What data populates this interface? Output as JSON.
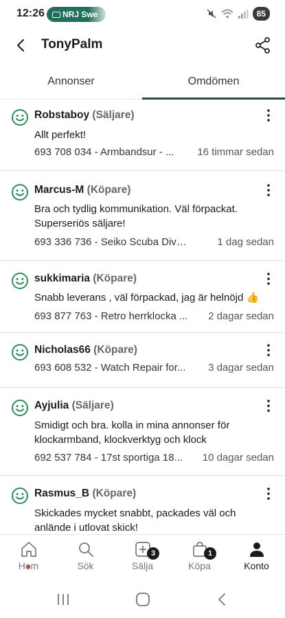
{
  "status_bar": {
    "time": "12:26",
    "notification": "NRJ Swe",
    "battery": "85"
  },
  "header": {
    "title": "TonyPalm",
    "back_icon": "chevron-left-icon",
    "share_icon": "share-icon"
  },
  "tabs": [
    {
      "label": "Annonser",
      "active": false
    },
    {
      "label": "Omdömen",
      "active": true
    }
  ],
  "reviews": [
    {
      "user": "Robstaboy",
      "role": "(Säljare)",
      "text": "Allt perfekt!",
      "item": "693 708 034 - Armbandsur - ...",
      "time": "16 timmar sedan"
    },
    {
      "user": "Marcus-M",
      "role": "(Köpare)",
      "text": "Bra och tydlig kommunikation. Väl förpackat. Superseriös säljare!",
      "item": "693 336 736 - Seiko Scuba Diver'...",
      "time": "1 dag sedan"
    },
    {
      "user": "sukkimaria",
      "role": "(Köpare)",
      "text": "Snabb leverans , väl förpackad, jag är helnöjd 👍",
      "item": "693 877 763 - Retro herrklocka ...",
      "time": "2 dagar sedan"
    },
    {
      "user": "Nicholas66",
      "role": "(Köpare)",
      "text": "",
      "item": "693 608 532 - Watch Repair for...",
      "time": "3 dagar sedan"
    },
    {
      "user": "Ayjulia",
      "role": "(Säljare)",
      "text": "Smidigt och bra. kolla in mina annonser för klockarmband, klockverktyg och klock",
      "item": "692 537 784 - 17st sportiga 18...",
      "time": "10 dagar sedan"
    },
    {
      "user": "Rasmus_B",
      "role": "(Köpare)",
      "text": "Skickades mycket snabbt, packades väl och anlände i utlovat skick!",
      "item": "",
      "time": ""
    }
  ],
  "bottom_nav": [
    {
      "label": "Hem",
      "icon": "home-icon"
    },
    {
      "label": "Sök",
      "icon": "search-icon"
    },
    {
      "label": "Sälja",
      "icon": "add-icon",
      "badge": "3"
    },
    {
      "label": "Köpa",
      "icon": "bag-icon",
      "badge": "1"
    },
    {
      "label": "Konto",
      "icon": "person-icon",
      "active": true
    }
  ],
  "colors": {
    "accent": "#1f4d3a",
    "smiley": "#2e8b57",
    "notification_dot": "#d0342c"
  }
}
